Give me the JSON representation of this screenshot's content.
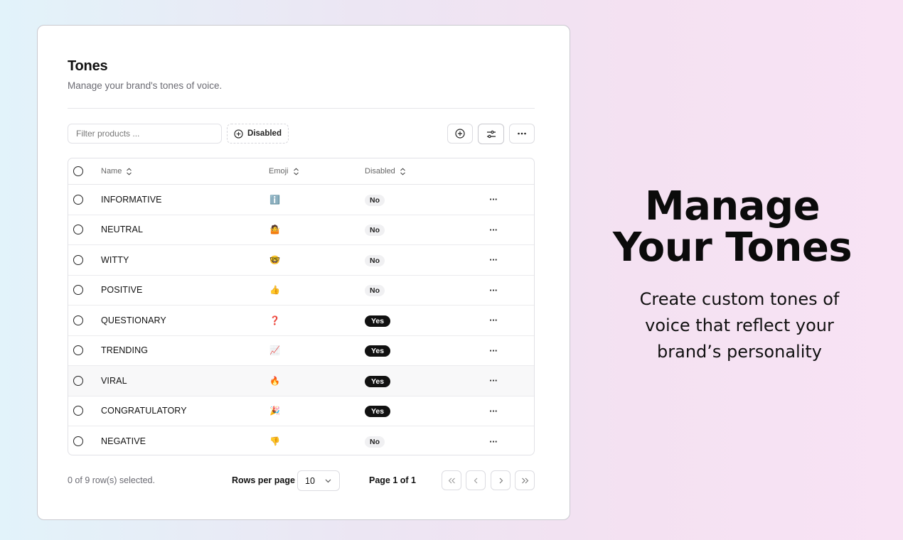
{
  "card": {
    "title": "Tones",
    "subtitle": "Manage your brand's tones of voice."
  },
  "toolbar": {
    "filter_placeholder": "Filter products ...",
    "disabled_chip": "Disabled"
  },
  "table": {
    "headers": {
      "name": "Name",
      "emoji": "Emoji",
      "disabled": "Disabled"
    },
    "rows": [
      {
        "name": "INFORMATIVE",
        "emoji": "ℹ️",
        "disabled": "No"
      },
      {
        "name": "NEUTRAL",
        "emoji": "🤷",
        "disabled": "No"
      },
      {
        "name": "WITTY",
        "emoji": "🤓",
        "disabled": "No"
      },
      {
        "name": "POSITIVE",
        "emoji": "👍",
        "disabled": "No"
      },
      {
        "name": "QUESTIONARY",
        "emoji": "❓",
        "disabled": "Yes"
      },
      {
        "name": "TRENDING",
        "emoji": "📈",
        "disabled": "Yes"
      },
      {
        "name": "VIRAL",
        "emoji": "🔥",
        "disabled": "Yes"
      },
      {
        "name": "CONGRATULATORY",
        "emoji": "🎉",
        "disabled": "Yes"
      },
      {
        "name": "NEGATIVE",
        "emoji": "👎",
        "disabled": "No"
      }
    ],
    "row_action": "···"
  },
  "footer": {
    "selected": "0 of 9 row(s) selected.",
    "rows_per_page_label": "Rows per page",
    "rows_per_page_value": "10",
    "page_label": "Page 1 of 1"
  },
  "hero": {
    "title_line1": "Manage",
    "title_line2": "Your Tones",
    "sub_line1": "Create custom tones of",
    "sub_line2": "voice that reflect your",
    "sub_line3": "brand’s personality"
  },
  "colors": {
    "badge_yes": "#111111",
    "badge_no": "#f0f0f2"
  }
}
